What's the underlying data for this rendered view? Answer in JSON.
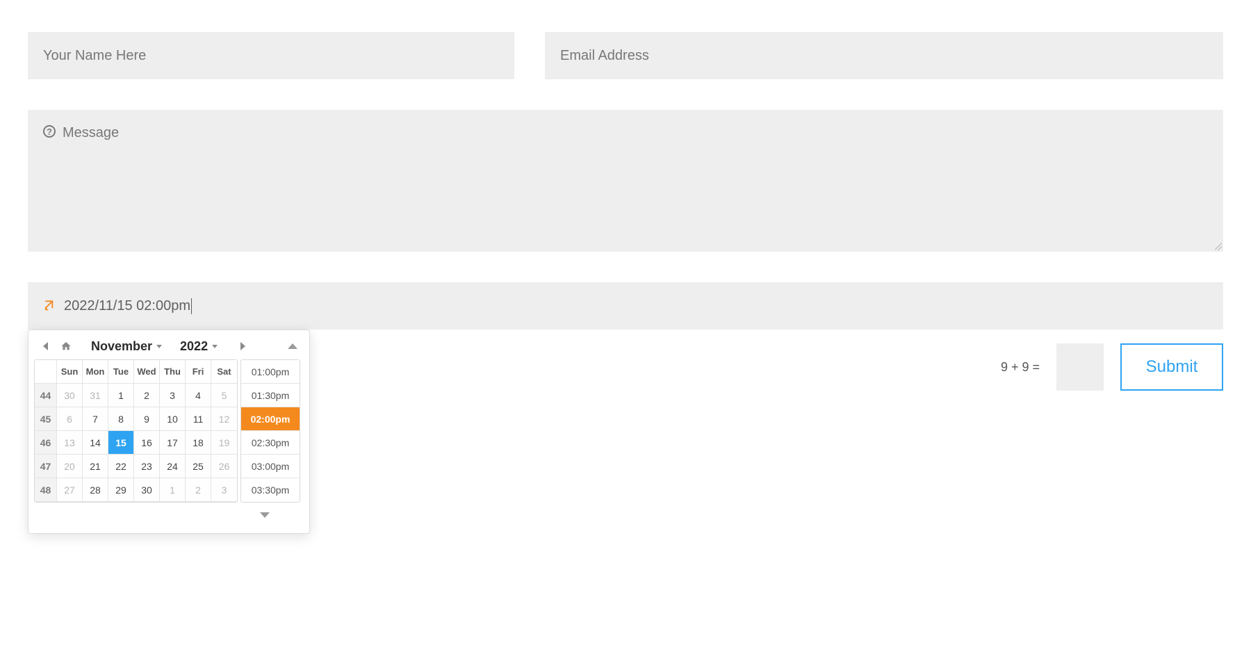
{
  "form": {
    "name_placeholder": "Your Name Here",
    "email_placeholder": "Email Address",
    "message_placeholder": "Message",
    "datetime_value": "2022/11/15 02:00pm",
    "captcha_label": "9 + 9 =",
    "submit_label": "Submit"
  },
  "picker": {
    "month_label": "November",
    "year_label": "2022",
    "day_headers": [
      "Sun",
      "Mon",
      "Tue",
      "Wed",
      "Thu",
      "Fri",
      "Sat"
    ],
    "weeks": [
      {
        "wk": "44",
        "days": [
          {
            "d": "30",
            "muted": true
          },
          {
            "d": "31",
            "muted": true
          },
          {
            "d": "1"
          },
          {
            "d": "2"
          },
          {
            "d": "3"
          },
          {
            "d": "4"
          },
          {
            "d": "5",
            "muted": true
          }
        ]
      },
      {
        "wk": "45",
        "days": [
          {
            "d": "6",
            "muted": true
          },
          {
            "d": "7"
          },
          {
            "d": "8"
          },
          {
            "d": "9"
          },
          {
            "d": "10"
          },
          {
            "d": "11"
          },
          {
            "d": "12",
            "muted": true
          }
        ]
      },
      {
        "wk": "46",
        "days": [
          {
            "d": "13",
            "muted": true
          },
          {
            "d": "14"
          },
          {
            "d": "15",
            "selected": true
          },
          {
            "d": "16"
          },
          {
            "d": "17"
          },
          {
            "d": "18"
          },
          {
            "d": "19",
            "muted": true
          }
        ]
      },
      {
        "wk": "47",
        "days": [
          {
            "d": "20",
            "muted": true
          },
          {
            "d": "21"
          },
          {
            "d": "22"
          },
          {
            "d": "23"
          },
          {
            "d": "24"
          },
          {
            "d": "25"
          },
          {
            "d": "26",
            "muted": true
          }
        ]
      },
      {
        "wk": "48",
        "days": [
          {
            "d": "27",
            "muted": true
          },
          {
            "d": "28"
          },
          {
            "d": "29"
          },
          {
            "d": "30"
          },
          {
            "d": "1",
            "muted": true
          },
          {
            "d": "2",
            "muted": true
          },
          {
            "d": "3",
            "muted": true
          }
        ]
      }
    ],
    "times": [
      {
        "t": "01:00pm"
      },
      {
        "t": "01:30pm"
      },
      {
        "t": "02:00pm",
        "selected": true
      },
      {
        "t": "02:30pm"
      },
      {
        "t": "03:00pm"
      },
      {
        "t": "03:30pm"
      }
    ]
  },
  "colors": {
    "accent_blue": "#2ea3f2",
    "accent_orange": "#f48a1e",
    "field_bg": "#eeeeee"
  }
}
